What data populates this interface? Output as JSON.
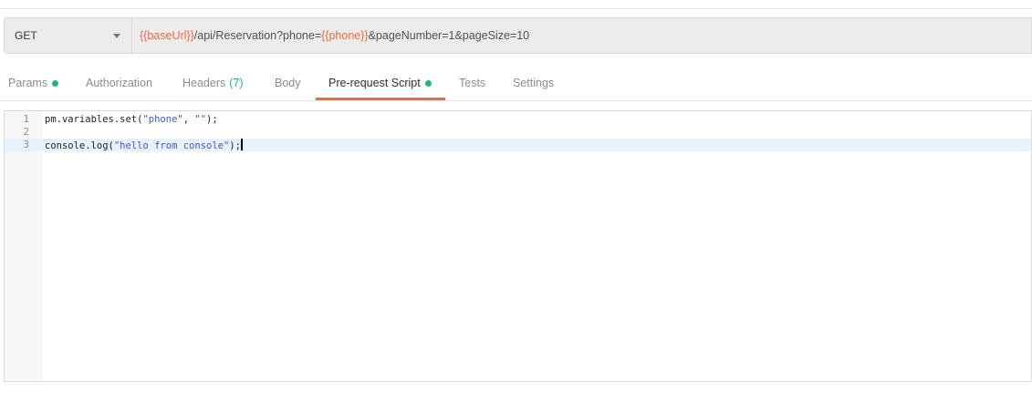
{
  "request": {
    "method": "GET",
    "url_parts": [
      {
        "text": "{{baseUrl}}",
        "kind": "var"
      },
      {
        "text": "/api/Reservation?phone=",
        "kind": "plain"
      },
      {
        "text": "{{phone}}",
        "kind": "var"
      },
      {
        "text": "&pageNumber=1&pageSize=10",
        "kind": "plain"
      }
    ]
  },
  "tabs": [
    {
      "label": "Params",
      "dot": true
    },
    {
      "label": "Authorization"
    },
    {
      "label": "Headers",
      "count": "(7)"
    },
    {
      "label": "Body"
    },
    {
      "label": "Pre-request Script",
      "dot": true,
      "active": true
    },
    {
      "label": "Tests"
    },
    {
      "label": "Settings"
    }
  ],
  "editor": {
    "lines": [
      {
        "number": "1",
        "tokens": [
          {
            "text": "pm.variables.set(",
            "kind": "plain"
          },
          {
            "text": "\"phone\"",
            "kind": "str"
          },
          {
            "text": ", ",
            "kind": "plain"
          },
          {
            "text": "\"\"",
            "kind": "str"
          },
          {
            "text": ");",
            "kind": "plain"
          }
        ]
      },
      {
        "number": "2",
        "tokens": []
      },
      {
        "number": "3",
        "current": true,
        "tokens": [
          {
            "text": "console.log(",
            "kind": "plain"
          },
          {
            "text": "\"hello from console\"",
            "kind": "str"
          },
          {
            "text": ");",
            "kind": "plain"
          }
        ]
      }
    ]
  },
  "colors": {
    "accent": "#f26b3a",
    "variable": "#f26b3a",
    "status_dot": "#26b47f",
    "string": "#3c5ac6",
    "current_line": "#e8f2fe"
  }
}
